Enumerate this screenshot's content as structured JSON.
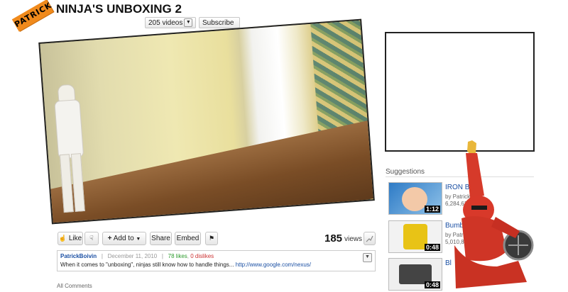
{
  "channel": {
    "tag": "PATRICK",
    "title": "NINJA'S UNBOXING 2"
  },
  "header": {
    "videos_label": "205 videos",
    "subscribe_label": "Subscribe"
  },
  "suggestions": {
    "heading": "Suggestions",
    "items": [
      {
        "title": "IRON BA",
        "by": "by Patrick",
        "views": "6,284,62",
        "duration": "1:12"
      },
      {
        "title": "Bumble",
        "by": "by Patrick",
        "views": "5,010,87",
        "duration": "0:48"
      },
      {
        "title": "Bl",
        "by": "",
        "views": "",
        "duration": "0:48"
      }
    ]
  },
  "actions": {
    "like": "Like",
    "add_to": "Add to",
    "share": "Share",
    "embed": "Embed"
  },
  "stats": {
    "views_count": "185",
    "views_label": "views"
  },
  "info": {
    "uploader": "PatrickBoivin",
    "separator": "|",
    "date": "December 11, 2010",
    "likes": "78 likes",
    "dislikes": "0 dislikes",
    "description": "When it comes to \"unboxing\", ninjas still know how to handle things...",
    "link": "http://www.google.com/nexus/"
  },
  "comments_label": "All Comments"
}
